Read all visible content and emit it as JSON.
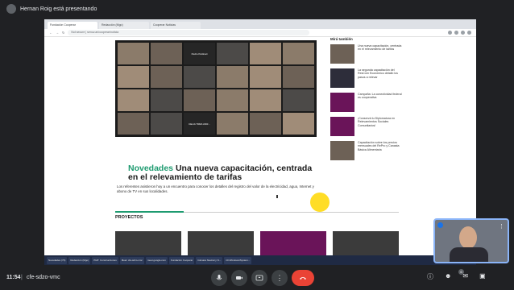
{
  "meet": {
    "presenting_banner": "Hernan Roig está presentando",
    "clock": "11:54",
    "separator": "|",
    "meeting_code": "cfe-sdzo-vmc",
    "participant_count": "6",
    "colors": {
      "background": "#202124",
      "end_call": "#ea4335",
      "self_border": "#8ab4f8"
    }
  },
  "browser": {
    "tabs": [
      {
        "label": "Fundación Cooperar"
      },
      {
        "label": "Redacción (Mgo)"
      },
      {
        "label": "Cooperar Noticias"
      }
    ],
    "url": "Not secure | senuv.ar/cooperar/noticia"
  },
  "article": {
    "hero_label": "Pedro Pettinari",
    "hero_label_2": "CELIA TRES ANR...",
    "headline_tag": "Novedades",
    "headline_text": "Una nueva capacitación, centrada en el relevamiento de tarifas",
    "summary": "Los referentes asistieron hoy a un encuentro para conocer los detalles del registro del valor de la electricidad, agua, Internet y abono de TV en sus localidades.",
    "section_title": "PROYECTOS",
    "accent_color": "#1e9b70"
  },
  "sidebar": {
    "title": "Mirá también",
    "items": [
      {
        "text": "Una nueva capacitación, centrada en el relevamiento de tarifas"
      },
      {
        "text": "La segunda capacitación del ResCom Económico detalló los pasos a relevar"
      },
      {
        "text": "Campaña: La conectividad federal es cooperativa"
      },
      {
        "text": "¡Conservá tu Diplomatura en Relevamientos Sociales Comunitarios!"
      },
      {
        "text": "Capacitación sobre los precios mensuales del RePro y Canasta Básica Alimentaria"
      }
    ]
  },
  "taskbar": {
    "items": [
      {
        "label": "Novedades (73)"
      },
      {
        "label": "Redacción (Mgo)"
      },
      {
        "label": "PHP: Construcciones"
      },
      {
        "label": "Meet: cfe-sdzo-vmc"
      },
      {
        "label": "meet.google.com"
      },
      {
        "label": "Fundación Cooperar"
      },
      {
        "label": "Cámara Neutral y N..."
      },
      {
        "label": "CF.Windows\\System..."
      }
    ],
    "clock": "18/11/2021"
  }
}
